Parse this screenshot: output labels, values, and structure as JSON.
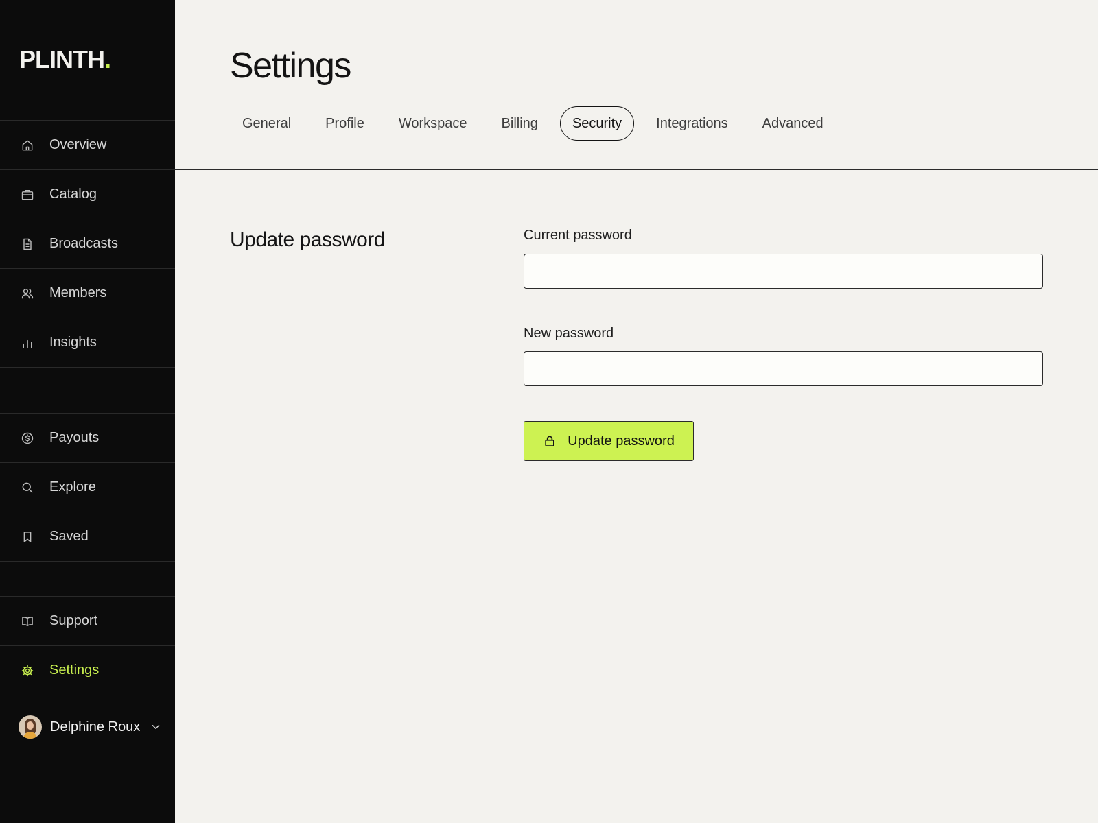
{
  "sidebar": {
    "logo_text": "PLINTH",
    "logo_dot": ".",
    "accent_color": "#c8ef4f",
    "groups": [
      {
        "items": [
          {
            "label": "Overview",
            "icon": "home-icon"
          },
          {
            "label": "Catalog",
            "icon": "briefcase-icon"
          },
          {
            "label": "Broadcasts",
            "icon": "document-icon"
          },
          {
            "label": "Members",
            "icon": "users-icon"
          },
          {
            "label": "Insights",
            "icon": "bar-chart-icon"
          }
        ]
      },
      {
        "items": [
          {
            "label": "Payouts",
            "icon": "dollar-circle-icon"
          },
          {
            "label": "Explore",
            "icon": "search-icon"
          },
          {
            "label": "Saved",
            "icon": "bookmark-icon"
          }
        ]
      },
      {
        "items": [
          {
            "label": "Support",
            "icon": "book-icon"
          },
          {
            "label": "Settings",
            "icon": "gear-icon",
            "active": true
          }
        ]
      }
    ],
    "user": {
      "name": "Delphine Roux",
      "icon": "chevron-down-icon"
    }
  },
  "main": {
    "title": "Settings",
    "tabs": [
      {
        "label": "General"
      },
      {
        "label": "Profile"
      },
      {
        "label": "Workspace"
      },
      {
        "label": "Billing"
      },
      {
        "label": "Security",
        "active": true
      },
      {
        "label": "Integrations"
      },
      {
        "label": "Advanced"
      }
    ],
    "section": {
      "title": "Update password",
      "fields": {
        "current_password": {
          "label": "Current password",
          "value": "",
          "placeholder": ""
        },
        "new_password": {
          "label": "New password",
          "value": "",
          "placeholder": ""
        }
      },
      "submit": {
        "label": "Update password",
        "icon": "lock-icon",
        "color": "#cdf252"
      }
    }
  }
}
